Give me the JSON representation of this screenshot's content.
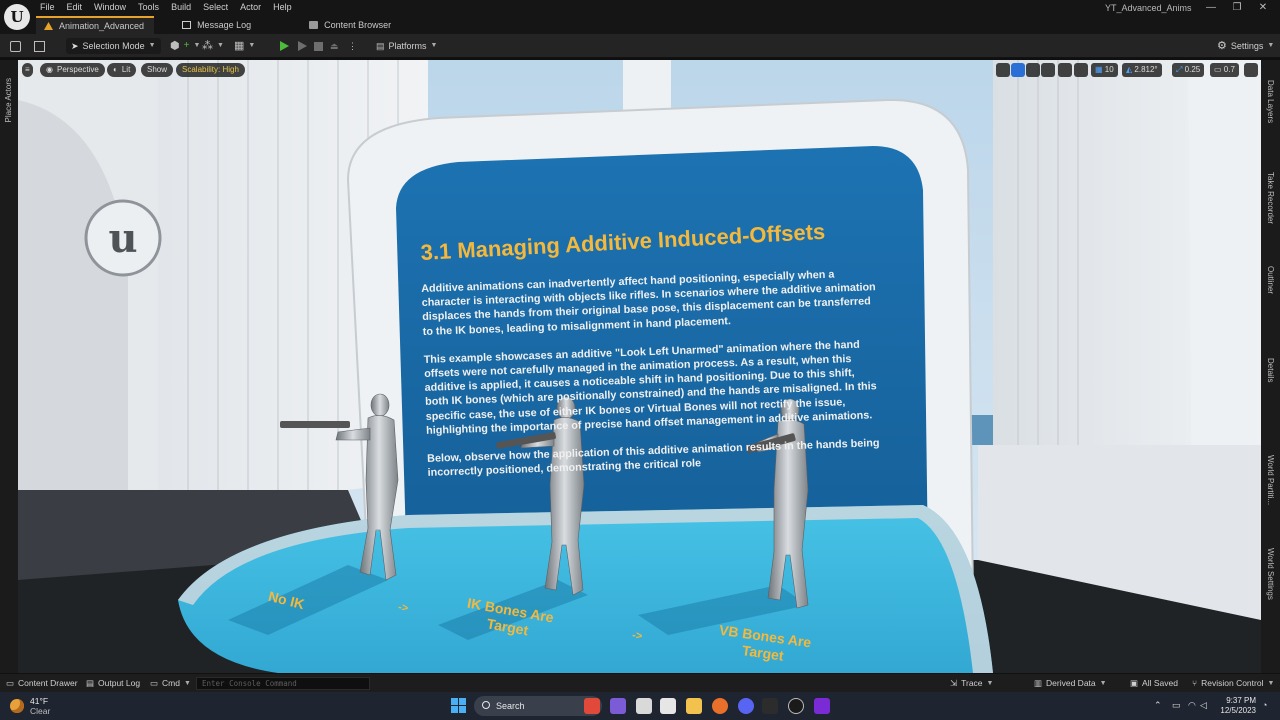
{
  "menu": [
    "File",
    "Edit",
    "Window",
    "Tools",
    "Build",
    "Select",
    "Actor",
    "Help"
  ],
  "project_name": "YT_Advanced_Anims",
  "window_controls": [
    "—",
    "❐",
    "✕"
  ],
  "tabs": [
    {
      "label": "Animation_Advanced",
      "active": true
    },
    {
      "label": "Message Log",
      "active": false
    },
    {
      "label": "Content Browser",
      "active": false
    }
  ],
  "toolbar": {
    "selection_mode": "Selection Mode",
    "platforms": "Platforms",
    "settings": "Settings"
  },
  "viewport": {
    "perspective": "Perspective",
    "lit": "Lit",
    "show": "Show",
    "scalability": "Scalability: High",
    "grid_value": "10",
    "angle_value": "2.812°",
    "scale_value": "0.25",
    "camera_speed": "0.7"
  },
  "left_rail": {
    "place_actors": "Place Actors"
  },
  "right_rail": [
    "Data Layers",
    "Take Recorder",
    "Outliner",
    "Details",
    "World Partiti...",
    "World Settings"
  ],
  "board": {
    "title": "3.1 Managing Additive Induced-Offsets",
    "paragraphs": [
      "Additive animations can inadvertently affect hand positioning, especially when a character is interacting with objects like rifles. In scenarios where the additive animation displaces the hands from their original base pose, this displacement can be transferred to the IK bones, leading to misalignment in hand placement.",
      "This example showcases an additive \"Look Left Unarmed\" animation where the hand offsets were not carefully managed in the animation process. As a result, when this additive is applied, it causes a noticeable shift in hand positioning. Due to this shift, both IK bones (which are positionally constrained) and the hands are misaligned. In this specific case, the use of either IK bones or Virtual Bones will not rectify the issue, highlighting the importance of precise hand offset management in additive animations.",
      "Below, observe how the application of this additive animation results in the hands being incorrectly positioned, demonstrating the critical role"
    ]
  },
  "floor_labels": [
    "No IK",
    "->",
    "IK Bones Are Target",
    "->",
    "VB Bones Are Target"
  ],
  "statusbar": {
    "content_drawer": "Content Drawer",
    "output_log": "Output Log",
    "cmd": "Cmd",
    "console_placeholder": "Enter Console Command",
    "trace": "Trace",
    "derived_data": "Derived Data",
    "all_saved": "All Saved",
    "revision_control": "Revision Control"
  },
  "taskbar": {
    "temperature": "41°F",
    "weather": "Clear",
    "search": "Search",
    "time": "9:37 PM",
    "date": "12/5/2023"
  },
  "colors": {
    "accent_orange": "#e6a22b",
    "board_blue": "#1a6fae",
    "board_title": "#f4b83c",
    "floor_cyan": "#3fb9e0",
    "play_green": "#4cba3b"
  }
}
